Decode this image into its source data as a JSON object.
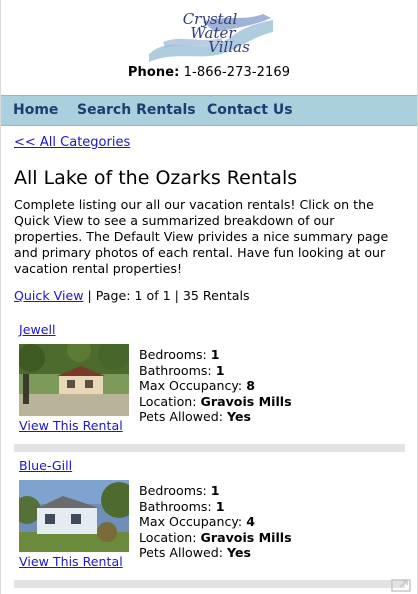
{
  "header": {
    "logo_line1": "Crystal",
    "logo_line2": "Water",
    "logo_line3": "Villas",
    "phone_label": "Phone:",
    "phone_number": "1-866-273-2169",
    "logo_colors": {
      "text": "#2f3e7c",
      "wave_light": "#a7c8dc",
      "wave_dark": "#8fa4cf"
    }
  },
  "nav": {
    "items": [
      {
        "label": "Home"
      },
      {
        "label": "Search Rentals"
      },
      {
        "label": "Contact Us"
      }
    ],
    "bg_color": "#a9d0dc",
    "text_color": "#1f3c70"
  },
  "main": {
    "back_link": "<< All Categories",
    "title": "All Lake of the Ozarks Rentals",
    "intro": "Complete listing our all our vacation rentals! Click on the Quick View to see a summarized breakdown of our properties. The Default View privides a nice summary page and primary photos of each rental. Have fun looking at our vacation rental properties!",
    "quick_view": "Quick View",
    "page_info": " | Page: 1 of 1 | 35 Rentals"
  },
  "rentals": [
    {
      "name": "Jewell",
      "bedrooms_label": "Bedrooms:",
      "bedrooms": "1",
      "bathrooms_label": "Bathrooms:",
      "bathrooms": "1",
      "occupancy_label": "Max Occupancy:",
      "occupancy": "8",
      "location_label": "Location:",
      "location": "Gravois Mills",
      "pets_label": "Pets Allowed:",
      "pets": "Yes",
      "view_label": "View This Rental"
    },
    {
      "name": "Blue-Gill",
      "bedrooms_label": "Bedrooms:",
      "bedrooms": "1",
      "bathrooms_label": "Bathrooms:",
      "bathrooms": "1",
      "occupancy_label": "Max Occupancy:",
      "occupancy": "4",
      "location_label": "Location:",
      "location": "Gravois Mills",
      "pets_label": "Pets Allowed:",
      "pets": "Yes",
      "view_label": "View This Rental"
    }
  ],
  "icons": {
    "corner": "external-share-icon"
  },
  "link_color": "#1a17c7"
}
